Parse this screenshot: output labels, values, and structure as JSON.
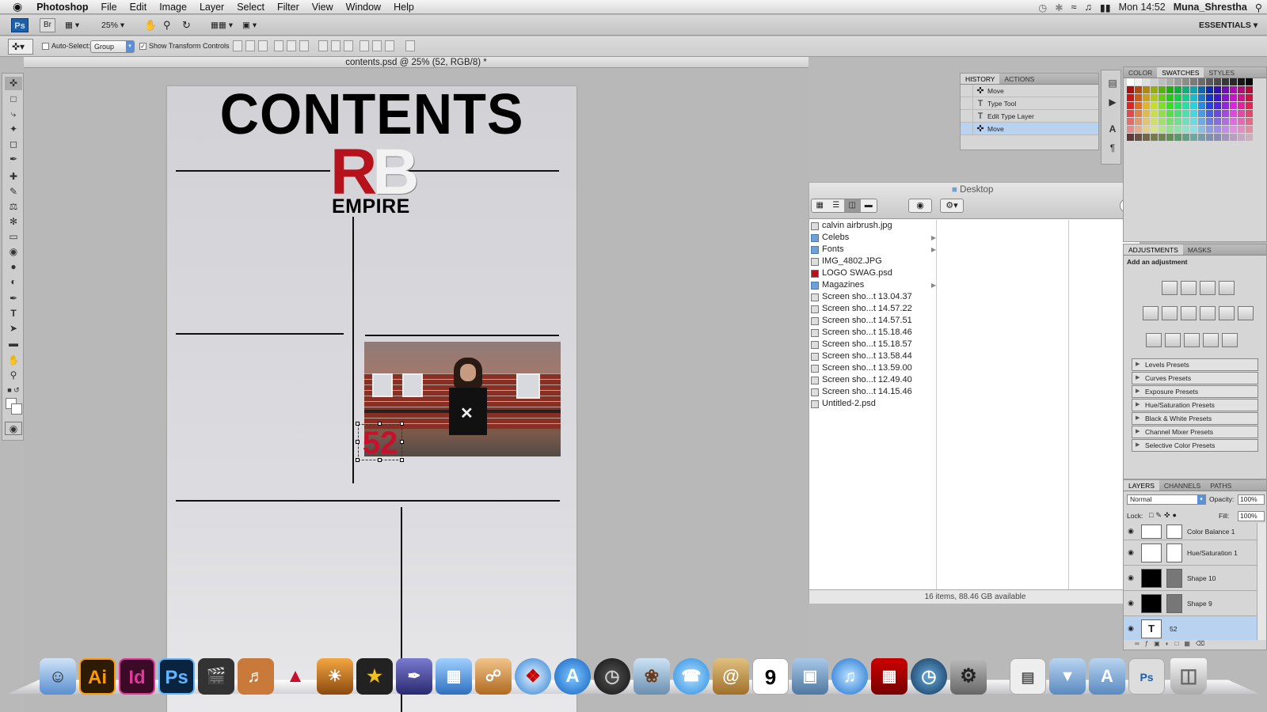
{
  "menubar": {
    "app_name": "Photoshop",
    "items": [
      "File",
      "Edit",
      "Image",
      "Layer",
      "Select",
      "Filter",
      "View",
      "Window",
      "Help"
    ],
    "clock": "Mon 14:52",
    "user": "Muna_Shrestha"
  },
  "appbar": {
    "ps_badge": "Ps",
    "br_badge": "Br",
    "zoom": "25%",
    "workspace": "ESSENTIALS ▾"
  },
  "options": {
    "auto_select_label": "Auto-Select:",
    "auto_select_value": "Group",
    "show_transform_label": "Show Transform Controls"
  },
  "document": {
    "tab_title": "contents.psd @ 25% (52, RGB/8) *"
  },
  "canvas": {
    "title": "CONTENTS",
    "logo_r": "R",
    "logo_b": "B",
    "logo_sub": "EMPIRE",
    "page_number": "52"
  },
  "finder": {
    "title": "Desktop",
    "items": [
      {
        "name": "calvin airbrush.jpg",
        "type": "file"
      },
      {
        "name": "Celebs",
        "type": "folder"
      },
      {
        "name": "Fonts",
        "type": "folder"
      },
      {
        "name": "IMG_4802.JPG",
        "type": "file"
      },
      {
        "name": "LOGO SWAG.psd",
        "type": "file"
      },
      {
        "name": "Magazines",
        "type": "folder"
      },
      {
        "name": "Screen sho...t 13.04.37",
        "type": "file"
      },
      {
        "name": "Screen sho...t 14.57.22",
        "type": "file"
      },
      {
        "name": "Screen sho...t 14.57.51",
        "type": "file"
      },
      {
        "name": "Screen sho...t 15.18.46",
        "type": "file"
      },
      {
        "name": "Screen sho...t 15.18.57",
        "type": "file"
      },
      {
        "name": "Screen sho...t 13.58.44",
        "type": "file"
      },
      {
        "name": "Screen sho...t 13.59.00",
        "type": "file"
      },
      {
        "name": "Screen sho...t 12.49.40",
        "type": "file"
      },
      {
        "name": "Screen sho...t 14.15.46",
        "type": "file"
      },
      {
        "name": "Untitled-2.psd",
        "type": "file"
      }
    ],
    "status": "16 items, 88.46 GB available"
  },
  "history": {
    "tabs": [
      "HISTORY",
      "ACTIONS"
    ],
    "rows": [
      {
        "label": "Move",
        "icon": "move-icon"
      },
      {
        "label": "Type Tool",
        "icon": "type-icon"
      },
      {
        "label": "Edit Type Layer",
        "icon": "type-icon"
      },
      {
        "label": "Move",
        "icon": "move-icon"
      }
    ]
  },
  "swatches": {
    "tabs": [
      "COLOR",
      "SWATCHES",
      "STYLES"
    ]
  },
  "adjustments": {
    "tabs": [
      "ADJUSTMENTS",
      "MASKS"
    ],
    "heading": "Add an adjustment",
    "presets": [
      "Levels Presets",
      "Curves Presets",
      "Exposure Presets",
      "Hue/Saturation Presets",
      "Black & White Presets",
      "Channel Mixer Presets",
      "Selective Color Presets"
    ]
  },
  "layers": {
    "tabs": [
      "LAYERS",
      "CHANNELS",
      "PATHS"
    ],
    "blend_mode": "Normal",
    "opacity_label": "Opacity:",
    "opacity_value": "100%",
    "lock_label": "Lock:",
    "fill_label": "Fill:",
    "fill_value": "100%",
    "rows": [
      {
        "name": "Color Balance 1"
      },
      {
        "name": "Hue/Saturation 1"
      },
      {
        "name": "Shape 10"
      },
      {
        "name": "Shape 9"
      },
      {
        "name": "52"
      }
    ]
  },
  "dock": {
    "ai": "Ai",
    "id": "Id",
    "ps": "Ps",
    "cal_day": "9"
  }
}
